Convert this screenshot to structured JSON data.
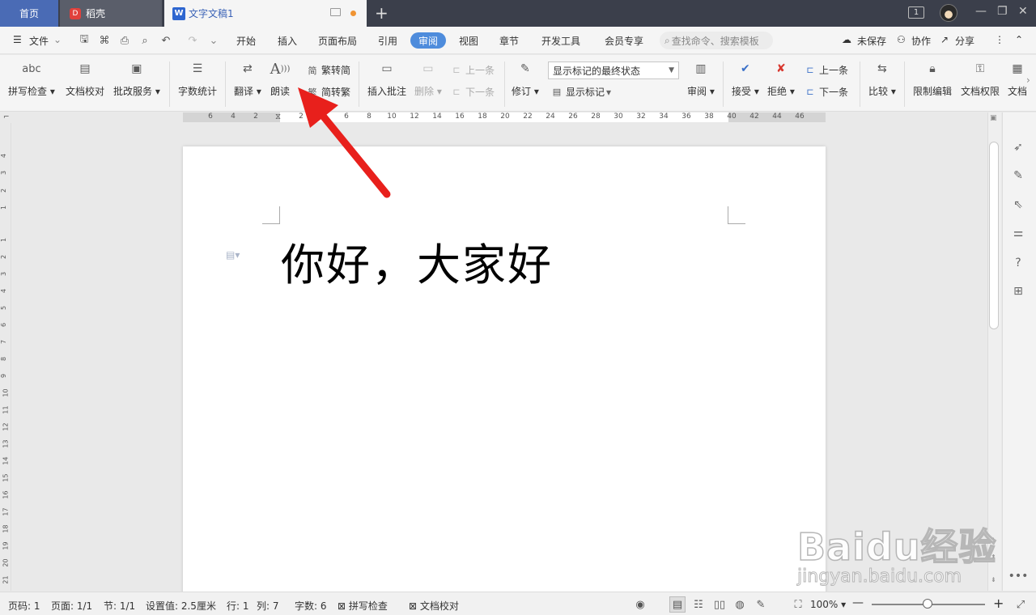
{
  "titlebar": {
    "tabs": [
      {
        "label": "首页"
      },
      {
        "label": "稻壳"
      },
      {
        "label": "文字文稿1"
      }
    ],
    "badge": "1",
    "doc_logo": "W",
    "daoke_logo": "D"
  },
  "menubar": {
    "file": "文件",
    "items": [
      "开始",
      "插入",
      "页面布局",
      "引用",
      "审阅",
      "视图",
      "章节",
      "开发工具",
      "会员专享"
    ],
    "search_placeholder": "查找命令、搜索模板",
    "right": [
      "未保存",
      "协作",
      "分享"
    ]
  },
  "ribbon": {
    "spell_check": "拼写检查",
    "spell_icon": "abc",
    "doc_proof": "文档校对",
    "batch_service": "批改服务",
    "word_count": "字数统计",
    "translate": "翻译",
    "read_aloud": "朗读",
    "read_icon": "A",
    "trad_to_simp": "繁转简",
    "simp_to_trad": "简转繁",
    "insert_comment": "插入批注",
    "delete": "删除",
    "prev_comment": "上一条",
    "next_comment": "下一条",
    "revise": "修订",
    "markup_state": "显示标记的最终状态",
    "show_markup": "显示标记",
    "review_pane": "审阅",
    "accept": "接受",
    "reject": "拒绝",
    "prev_change": "上一条",
    "next_change": "下一条",
    "compare": "比较",
    "restrict_edit": "限制编辑",
    "doc_rights": "文档权限",
    "doc_more": "文档"
  },
  "ruler": {
    "h_ticks": [
      "6",
      "4",
      "2",
      "2",
      "4",
      "6",
      "8",
      "10",
      "12",
      "14",
      "16",
      "18",
      "20",
      "22",
      "24",
      "26",
      "28",
      "30",
      "32",
      "34",
      "36",
      "38",
      "40",
      "42",
      "44",
      "46"
    ],
    "v_ticks": [
      "4",
      "3",
      "2",
      "1",
      "1",
      "2",
      "3",
      "4",
      "5",
      "6",
      "7",
      "8",
      "9",
      "10",
      "11",
      "12",
      "13",
      "14",
      "15",
      "16",
      "17",
      "18",
      "19",
      "20",
      "21"
    ]
  },
  "document": {
    "text": "你好，大家好"
  },
  "statusbar": {
    "page_code": "页码: 1",
    "page": "页面: 1/1",
    "section": "节: 1/1",
    "setting": "设置值: 2.5厘米",
    "row": "行: 1",
    "col": "列: 7",
    "word_count": "字数: 6",
    "spell_check": "拼写检查",
    "doc_proof": "文档校对",
    "zoom": "100%"
  },
  "watermark": {
    "brand": "Baidu经验",
    "url": "jingyan.baidu.com"
  },
  "colors": {
    "accent": "#4e8cdc",
    "titlebar": "#3b3f4b",
    "arrow": "#e8201c"
  }
}
